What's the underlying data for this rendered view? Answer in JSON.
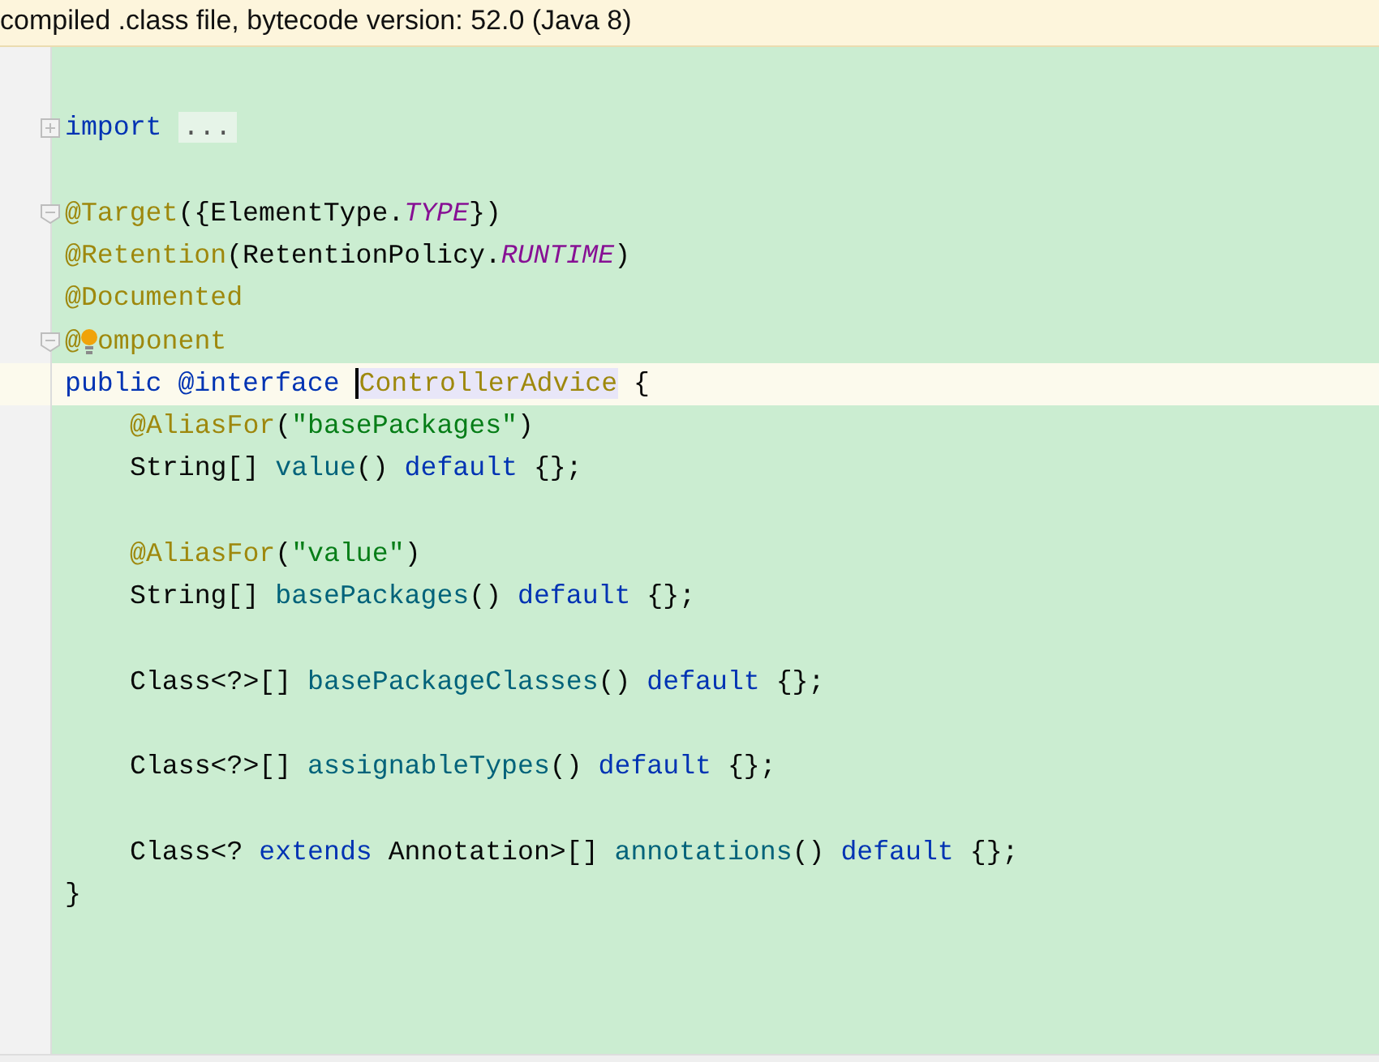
{
  "banner": {
    "text": "compiled .class file, bytecode version: 52.0 (Java 8)"
  },
  "lines": [
    {
      "kind": "blank"
    },
    {
      "kind": "code",
      "collapsed": true,
      "tokens": [
        {
          "text": "import ",
          "kind": "keyword"
        },
        {
          "text": "...",
          "kind": "folded"
        }
      ]
    },
    {
      "kind": "blank"
    },
    {
      "kind": "code",
      "collapsed": false,
      "tokens": [
        {
          "text": "@Target",
          "kind": "annotation"
        },
        {
          "text": "({ElementType.",
          "kind": "plain"
        },
        {
          "text": "TYPE",
          "kind": "constant"
        },
        {
          "text": "})",
          "kind": "plain"
        }
      ]
    },
    {
      "kind": "code",
      "tokens": [
        {
          "text": "@Retention",
          "kind": "annotation"
        },
        {
          "text": "(RetentionPolicy.",
          "kind": "plain"
        },
        {
          "text": "RUNTIME",
          "kind": "constant"
        },
        {
          "text": ")",
          "kind": "plain"
        }
      ]
    },
    {
      "kind": "code",
      "tokens": [
        {
          "text": "@Documented",
          "kind": "annotation"
        }
      ]
    },
    {
      "kind": "code",
      "collapsed": false,
      "bulb": true,
      "tokens": [
        {
          "text": "@",
          "kind": "annotation"
        },
        {
          "text": "omponent",
          "kind": "annotation"
        }
      ]
    },
    {
      "kind": "code",
      "current": true,
      "tokens": [
        {
          "text": "public @interface ",
          "kind": "keyword"
        },
        {
          "text": "ControllerAdvice",
          "kind": "annotation",
          "highlighted": true,
          "caret": true
        },
        {
          "text": " {",
          "kind": "plain"
        }
      ]
    },
    {
      "kind": "code",
      "indented": true,
      "tokens": [
        {
          "text": "@AliasFor",
          "kind": "annotation"
        },
        {
          "text": "(",
          "kind": "plain"
        },
        {
          "text": "\"basePackages\"",
          "kind": "string"
        },
        {
          "text": ")",
          "kind": "plain"
        }
      ]
    },
    {
      "kind": "code",
      "indented": true,
      "tokens": [
        {
          "text": "String[] ",
          "kind": "plain"
        },
        {
          "text": "value",
          "kind": "method"
        },
        {
          "text": "() ",
          "kind": "plain"
        },
        {
          "text": "default",
          "kind": "keyword"
        },
        {
          "text": " {};",
          "kind": "plain"
        }
      ]
    },
    {
      "kind": "blank"
    },
    {
      "kind": "code",
      "indented": true,
      "tokens": [
        {
          "text": "@AliasFor",
          "kind": "annotation"
        },
        {
          "text": "(",
          "kind": "plain"
        },
        {
          "text": "\"value\"",
          "kind": "string"
        },
        {
          "text": ")",
          "kind": "plain"
        }
      ]
    },
    {
      "kind": "code",
      "indented": true,
      "tokens": [
        {
          "text": "String[] ",
          "kind": "plain"
        },
        {
          "text": "basePackages",
          "kind": "method"
        },
        {
          "text": "() ",
          "kind": "plain"
        },
        {
          "text": "default",
          "kind": "keyword"
        },
        {
          "text": " {};",
          "kind": "plain"
        }
      ]
    },
    {
      "kind": "blank"
    },
    {
      "kind": "code",
      "indented": true,
      "tokens": [
        {
          "text": "Class<?>[] ",
          "kind": "plain"
        },
        {
          "text": "basePackageClasses",
          "kind": "method"
        },
        {
          "text": "() ",
          "kind": "plain"
        },
        {
          "text": "default",
          "kind": "keyword"
        },
        {
          "text": " {};",
          "kind": "plain"
        }
      ]
    },
    {
      "kind": "blank"
    },
    {
      "kind": "code",
      "indented": true,
      "tokens": [
        {
          "text": "Class<?>[] ",
          "kind": "plain"
        },
        {
          "text": "assignableTypes",
          "kind": "method"
        },
        {
          "text": "() ",
          "kind": "plain"
        },
        {
          "text": "default",
          "kind": "keyword"
        },
        {
          "text": " {};",
          "kind": "plain"
        }
      ]
    },
    {
      "kind": "blank"
    },
    {
      "kind": "code",
      "indented": true,
      "tokens": [
        {
          "text": "Class<? ",
          "kind": "plain"
        },
        {
          "text": "extends",
          "kind": "keyword"
        },
        {
          "text": " Annotation>[] ",
          "kind": "plain"
        },
        {
          "text": "annotations",
          "kind": "method"
        },
        {
          "text": "() ",
          "kind": "plain"
        },
        {
          "text": "default",
          "kind": "keyword"
        },
        {
          "text": " {};",
          "kind": "plain"
        }
      ]
    },
    {
      "kind": "code",
      "tokens": [
        {
          "text": "}",
          "kind": "plain"
        }
      ]
    }
  ]
}
